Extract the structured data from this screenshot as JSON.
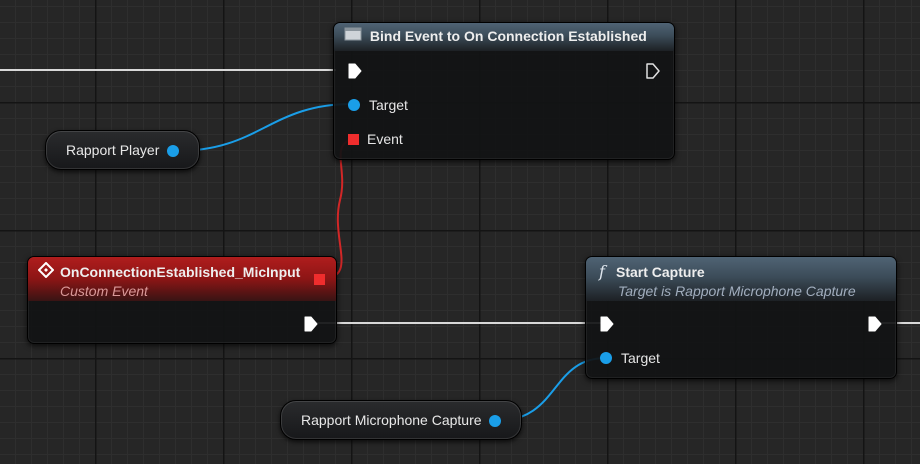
{
  "nodes": {
    "bind_event": {
      "title": "Bind Event to On Connection Established",
      "icon": "delegate-icon",
      "pins": {
        "target": "Target",
        "event": "Event"
      }
    },
    "rapport_player": {
      "label": "Rapport Player"
    },
    "custom_event": {
      "title": "OnConnectionEstablished_MicInput",
      "subtitle": "Custom Event",
      "icon": "event-diamond-icon"
    },
    "start_capture": {
      "title": "Start Capture",
      "subtitle": "Target is Rapport Microphone Capture",
      "icon": "function-icon",
      "pins": {
        "target": "Target"
      }
    },
    "mic_capture": {
      "label": "Rapport Microphone Capture"
    }
  },
  "colors": {
    "object_pin": "#1a9ee8",
    "delegate_pin": "#ef2d2d",
    "exec_wire": "#e0e0e0",
    "custom_event_header": "#b01d1d",
    "function_header": "#4f6374"
  }
}
